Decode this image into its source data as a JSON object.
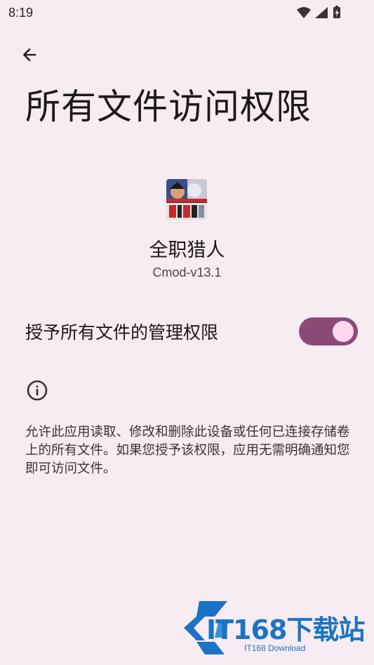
{
  "status_bar": {
    "time": "8:19",
    "icons": [
      "wifi-icon",
      "cellular-signal-icon",
      "battery-charging-icon"
    ]
  },
  "header": {
    "back_icon": "arrow-left-icon",
    "title": "所有文件访问权限"
  },
  "app": {
    "name": "全职猎人",
    "version": "Cmod-v13.1",
    "icon": "app-icon-hunter"
  },
  "permission": {
    "label": "授予所有文件的管理权限",
    "enabled": true
  },
  "info": {
    "icon": "info-icon",
    "text": "允许此应用读取、修改和删除此设备或任何已连接存储卷上的所有文件。如果您授予该权限，应用无需明确通知您即可访问文件。"
  },
  "watermark": {
    "brand": "IT168下载站",
    "subtitle": "IT168 Download"
  },
  "colors": {
    "background": "#f7ecf1",
    "toggle_track": "#8a4a78",
    "toggle_knob": "#ffd7f1",
    "watermark": "#1a73c7"
  }
}
